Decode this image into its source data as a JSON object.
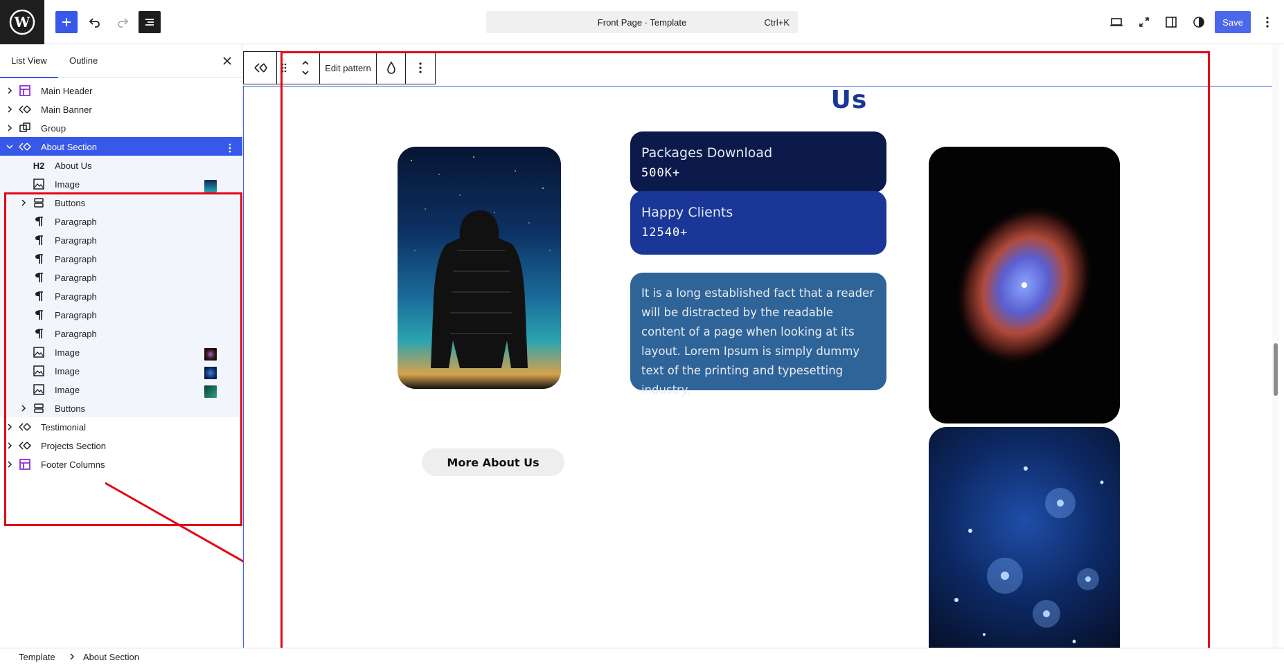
{
  "topbar": {
    "document_title": "Front Page · Template",
    "shortcut": "Ctrl+K",
    "save_label": "Save"
  },
  "sidebar": {
    "tabs": [
      "List View",
      "Outline"
    ],
    "items": [
      {
        "label": "Main Header",
        "icon": "template-part-icon",
        "level": 0,
        "expandable": true
      },
      {
        "label": "Main Banner",
        "icon": "pattern-icon",
        "level": 0,
        "expandable": true
      },
      {
        "label": "Group",
        "icon": "group-icon",
        "level": 0,
        "expandable": true
      },
      {
        "label": "About Section",
        "icon": "pattern-icon",
        "level": 0,
        "expandable": true,
        "selected": true
      },
      {
        "label": "About Us",
        "icon": "heading-icon",
        "icon_text": "H2",
        "level": 1
      },
      {
        "label": "Image",
        "icon": "image-icon",
        "level": 1,
        "thumb": "aurora"
      },
      {
        "label": "Buttons",
        "icon": "buttons-icon",
        "level": 1,
        "expandable": true
      },
      {
        "label": "Paragraph",
        "icon": "paragraph-icon",
        "level": 1
      },
      {
        "label": "Paragraph",
        "icon": "paragraph-icon",
        "level": 1
      },
      {
        "label": "Paragraph",
        "icon": "paragraph-icon",
        "level": 1
      },
      {
        "label": "Paragraph",
        "icon": "paragraph-icon",
        "level": 1
      },
      {
        "label": "Paragraph",
        "icon": "paragraph-icon",
        "level": 1
      },
      {
        "label": "Paragraph",
        "icon": "paragraph-icon",
        "level": 1
      },
      {
        "label": "Paragraph",
        "icon": "paragraph-icon",
        "level": 1
      },
      {
        "label": "Image",
        "icon": "image-icon",
        "level": 1,
        "thumb": "nebula"
      },
      {
        "label": "Image",
        "icon": "image-icon",
        "level": 1,
        "thumb": "stars"
      },
      {
        "label": "Image",
        "icon": "image-icon",
        "level": 1,
        "thumb": "green"
      },
      {
        "label": "Buttons",
        "icon": "buttons-icon",
        "level": 1,
        "expandable": true
      },
      {
        "label": "Testimonial",
        "icon": "pattern-icon",
        "level": 0,
        "expandable": true
      },
      {
        "label": "Projects Section",
        "icon": "pattern-icon",
        "level": 0,
        "expandable": true
      },
      {
        "label": "Footer Columns",
        "icon": "template-part-icon",
        "level": 0,
        "expandable": true
      }
    ]
  },
  "block_toolbar": {
    "edit_pattern_label": "Edit pattern"
  },
  "canvas": {
    "heading": "Us",
    "stats": [
      {
        "title": "Packages Download",
        "value": "500K+"
      },
      {
        "title": "Happy Clients",
        "value": "12540+"
      }
    ],
    "paragraph": "It is a long established fact that a reader will be distracted by the readable content of a page when looking at its layout. Lorem Ipsum is simply dummy text of the printing and typesetting industry.",
    "button_label": "More About Us"
  },
  "breadcrumb": [
    "Template",
    "About Section"
  ],
  "colors": {
    "accent": "#3858e9",
    "highlight": "#e30613",
    "heading": "#1a3696",
    "stat_dark": "#0b1a4a",
    "stat_blue": "#1a3696",
    "para_bg": "#2f6498"
  }
}
